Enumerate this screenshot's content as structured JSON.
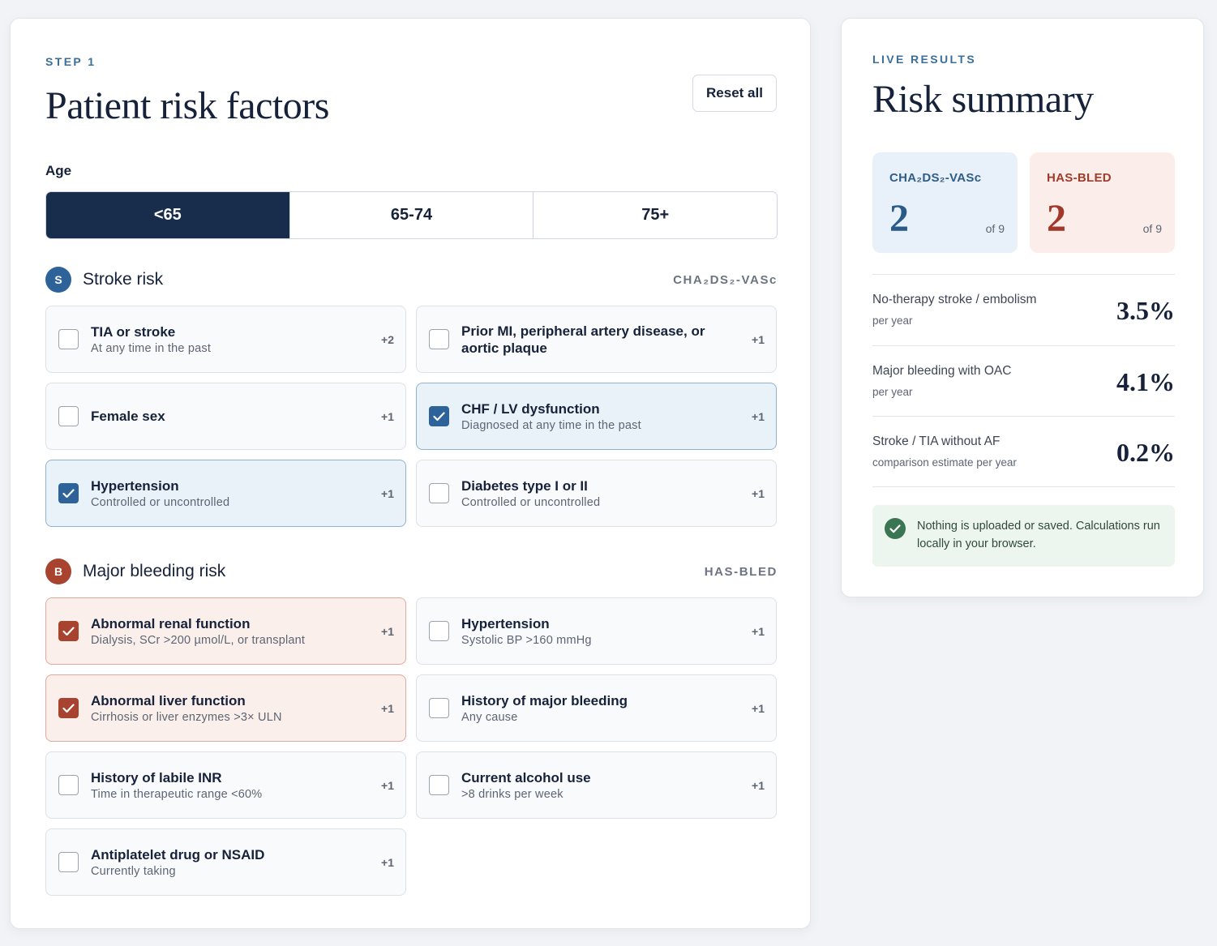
{
  "left": {
    "eyebrow": "STEP 1",
    "title": "Patient risk factors",
    "reset_label": "Reset all",
    "age": {
      "label": "Age",
      "options": [
        "<65",
        "65-74",
        "75+"
      ],
      "selected": "<65"
    },
    "stroke": {
      "badge": "S",
      "title": "Stroke risk",
      "tag": "CHA₂DS₂-VASc",
      "items": [
        {
          "title": "TIA or stroke",
          "sub": "At any time in the past",
          "points": "+2",
          "checked": false
        },
        {
          "title": "Prior MI, peripheral artery disease, or aortic plaque",
          "sub": "",
          "points": "+1",
          "checked": false
        },
        {
          "title": "Female sex",
          "sub": "",
          "points": "+1",
          "checked": false
        },
        {
          "title": "CHF / LV dysfunction",
          "sub": "Diagnosed at any time in the past",
          "points": "+1",
          "checked": true
        },
        {
          "title": "Hypertension",
          "sub": "Controlled or uncontrolled",
          "points": "+1",
          "checked": true
        },
        {
          "title": "Diabetes type I or II",
          "sub": "Controlled or uncontrolled",
          "points": "+1",
          "checked": false
        }
      ]
    },
    "bleeding": {
      "badge": "B",
      "title": "Major bleeding risk",
      "tag": "HAS-BLED",
      "items": [
        {
          "title": "Abnormal renal function",
          "sub": "Dialysis, SCr >200 µmol/L, or transplant",
          "points": "+1",
          "checked": true
        },
        {
          "title": "Hypertension",
          "sub": "Systolic BP >160 mmHg",
          "points": "+1",
          "checked": false
        },
        {
          "title": "Abnormal liver function",
          "sub": "Cirrhosis or liver enzymes >3× ULN",
          "points": "+1",
          "checked": true
        },
        {
          "title": "History of major bleeding",
          "sub": "Any cause",
          "points": "+1",
          "checked": false
        },
        {
          "title": "History of labile INR",
          "sub": "Time in therapeutic range <60%",
          "points": "+1",
          "checked": false
        },
        {
          "title": "Current alcohol use",
          "sub": ">8 drinks per week",
          "points": "+1",
          "checked": false
        },
        {
          "title": "Antiplatelet drug or NSAID",
          "sub": "Currently taking",
          "points": "+1",
          "checked": false
        }
      ]
    }
  },
  "right": {
    "eyebrow": "LIVE RESULTS",
    "title": "Risk summary",
    "scores": {
      "chads": {
        "name": "CHA₂DS₂-VASc",
        "value": "2",
        "of": "of 9"
      },
      "hasbled": {
        "name": "HAS-BLED",
        "value": "2",
        "of": "of 9"
      }
    },
    "stats": [
      {
        "label": "No-therapy stroke / embolism",
        "sub": "per year",
        "value": "3.5%"
      },
      {
        "label": "Major bleeding with OAC",
        "sub": "per year",
        "value": "4.1%"
      },
      {
        "label": "Stroke / TIA without AF",
        "sub": "comparison estimate per year",
        "value": "0.2%"
      }
    ],
    "privacy_note": "Nothing is uploaded or saved. Calculations run locally in your browser."
  },
  "colors": {
    "navy": "#182c4c",
    "stroke_accent": "#2d6399",
    "bleed_accent": "#a8432f",
    "success": "#3b7654"
  },
  "icons": {
    "checkbox_checked": "check-icon",
    "privacy": "check-circle-icon"
  }
}
